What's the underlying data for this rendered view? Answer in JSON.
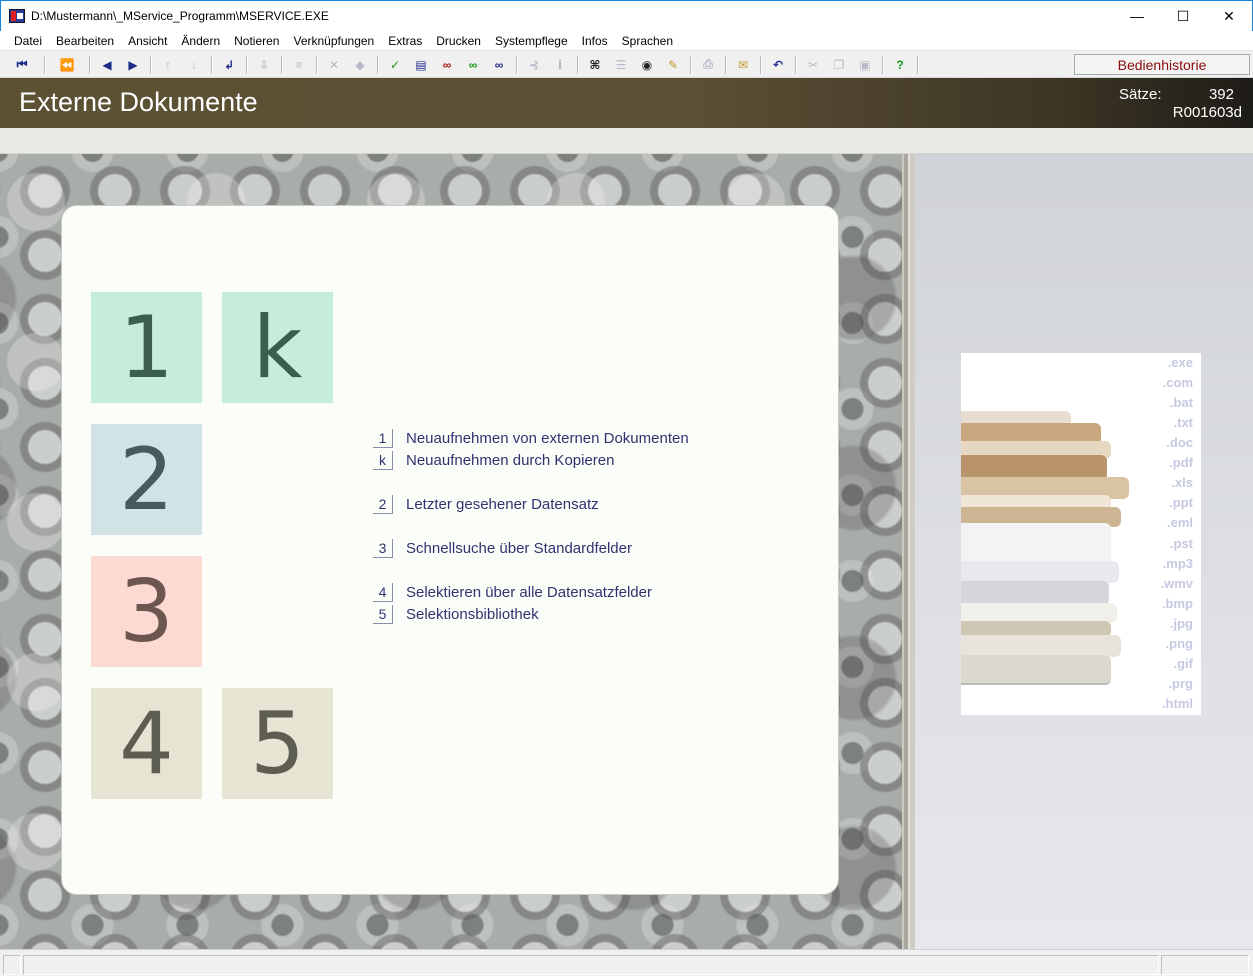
{
  "window": {
    "title": "D:\\Mustermann\\_MService_Programm\\MSERVICE.EXE",
    "controls": {
      "minimize": "—",
      "maximize": "☐",
      "close": "✕"
    }
  },
  "menu": [
    "Datei",
    "Bearbeiten",
    "Ansicht",
    "Ändern",
    "Notieren",
    "Verknüpfungen",
    "Extras",
    "Drucken",
    "Systempflege",
    "Infos",
    "Sprachen"
  ],
  "toolbar": {
    "history_label": "Bedienhistorie",
    "icons": [
      "first-record-icon",
      "prev-page-icon",
      "prev-record-icon",
      "next-record-icon",
      "up-arrow-icon",
      "down-arrow-icon",
      "return-icon",
      "export-icon",
      "list-icon",
      "delete-icon",
      "erase-icon",
      "confirm-icon",
      "document-icon",
      "link-red-icon",
      "link-green-icon",
      "link-blue-icon",
      "branch-icon",
      "info-icon",
      "binoculars-icon",
      "lines-icon",
      "eye-icon",
      "edit-icon",
      "print-icon",
      "mail-icon",
      "undo-icon",
      "cut-icon",
      "copy-icon",
      "paste-icon",
      "help-icon"
    ]
  },
  "header": {
    "title": "Externe Dokumente",
    "count_label": "Sätze:",
    "count_value": "392",
    "record_id": "R001603d"
  },
  "tiles": {
    "t1": "1",
    "tk": "k",
    "t2": "2",
    "t3": "3",
    "t4": "4",
    "t5": "5"
  },
  "options": [
    {
      "key": "1",
      "label": "Neuaufnehmen von externen Dokumenten"
    },
    {
      "key": "k",
      "label": "Neuaufnehmen durch Kopieren"
    },
    {
      "key": "2",
      "label": "Letzter gesehener Datensatz"
    },
    {
      "key": "3",
      "label": "Schnellsuche über Standardfelder"
    },
    {
      "key": "4",
      "label": "Selektieren über alle Datensatzfelder"
    },
    {
      "key": "5",
      "label": "Selektionsbibliothek"
    }
  ],
  "extensions": [
    ".exe",
    ".com",
    ".bat",
    ".txt",
    ".doc",
    ".pdf",
    ".xls",
    ".ppt",
    ".eml",
    ".pst",
    ".mp3",
    ".wmv",
    ".bmp",
    ".jpg",
    ".png",
    ".gif",
    ".prg",
    ".html"
  ],
  "colors": {
    "accent_text": "#2f3470",
    "history_text": "#8a0d0d",
    "banner": "#5d5134"
  }
}
